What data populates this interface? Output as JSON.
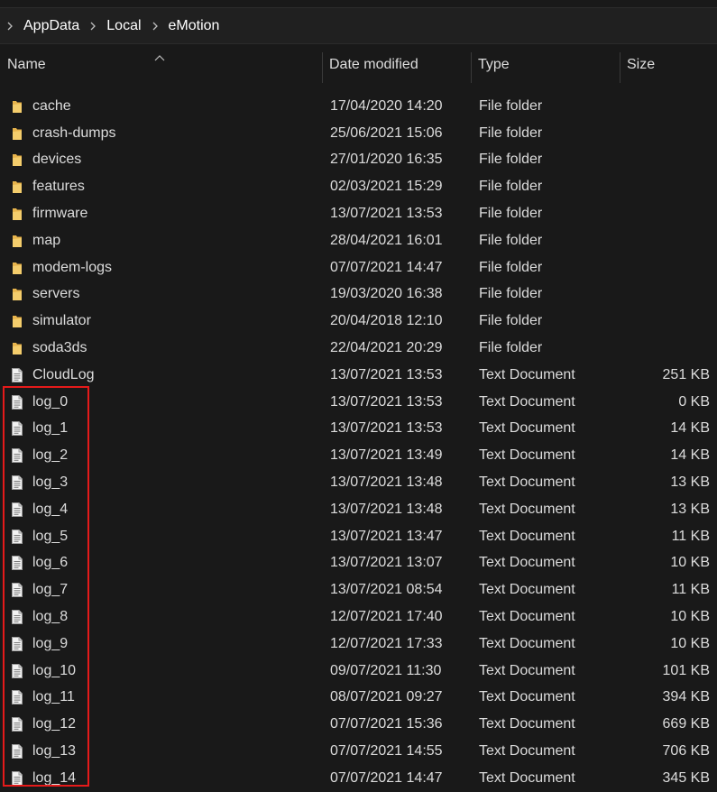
{
  "breadcrumb": {
    "items": [
      {
        "label": "AppData"
      },
      {
        "label": "Local"
      },
      {
        "label": "eMotion"
      }
    ]
  },
  "columns": {
    "name": "Name",
    "date": "Date modified",
    "type": "Type",
    "size": "Size"
  },
  "colors": {
    "background": "#191919",
    "folder": "#e8b44c",
    "text": "#dcdcdc",
    "selection_outline": "#e51a1a"
  },
  "files": [
    {
      "name": "cache",
      "date": "17/04/2020 14:20",
      "type": "File folder",
      "size": "",
      "icon": "folder-icon"
    },
    {
      "name": "crash-dumps",
      "date": "25/06/2021 15:06",
      "type": "File folder",
      "size": "",
      "icon": "folder-icon"
    },
    {
      "name": "devices",
      "date": "27/01/2020 16:35",
      "type": "File folder",
      "size": "",
      "icon": "folder-icon"
    },
    {
      "name": "features",
      "date": "02/03/2021 15:29",
      "type": "File folder",
      "size": "",
      "icon": "folder-icon"
    },
    {
      "name": "firmware",
      "date": "13/07/2021 13:53",
      "type": "File folder",
      "size": "",
      "icon": "folder-icon"
    },
    {
      "name": "map",
      "date": "28/04/2021 16:01",
      "type": "File folder",
      "size": "",
      "icon": "folder-icon"
    },
    {
      "name": "modem-logs",
      "date": "07/07/2021 14:47",
      "type": "File folder",
      "size": "",
      "icon": "folder-icon"
    },
    {
      "name": "servers",
      "date": "19/03/2020 16:38",
      "type": "File folder",
      "size": "",
      "icon": "folder-icon"
    },
    {
      "name": "simulator",
      "date": "20/04/2018 12:10",
      "type": "File folder",
      "size": "",
      "icon": "folder-icon"
    },
    {
      "name": "soda3ds",
      "date": "22/04/2021 20:29",
      "type": "File folder",
      "size": "",
      "icon": "folder-icon"
    },
    {
      "name": "CloudLog",
      "date": "13/07/2021 13:53",
      "type": "Text Document",
      "size": "251 KB",
      "icon": "text-document-icon"
    },
    {
      "name": "log_0",
      "date": "13/07/2021 13:53",
      "type": "Text Document",
      "size": "0 KB",
      "icon": "text-document-icon"
    },
    {
      "name": "log_1",
      "date": "13/07/2021 13:53",
      "type": "Text Document",
      "size": "14 KB",
      "icon": "text-document-icon"
    },
    {
      "name": "log_2",
      "date": "13/07/2021 13:49",
      "type": "Text Document",
      "size": "14 KB",
      "icon": "text-document-icon"
    },
    {
      "name": "log_3",
      "date": "13/07/2021 13:48",
      "type": "Text Document",
      "size": "13 KB",
      "icon": "text-document-icon"
    },
    {
      "name": "log_4",
      "date": "13/07/2021 13:48",
      "type": "Text Document",
      "size": "13 KB",
      "icon": "text-document-icon"
    },
    {
      "name": "log_5",
      "date": "13/07/2021 13:47",
      "type": "Text Document",
      "size": "11 KB",
      "icon": "text-document-icon"
    },
    {
      "name": "log_6",
      "date": "13/07/2021 13:07",
      "type": "Text Document",
      "size": "10 KB",
      "icon": "text-document-icon"
    },
    {
      "name": "log_7",
      "date": "13/07/2021 08:54",
      "type": "Text Document",
      "size": "11 KB",
      "icon": "text-document-icon"
    },
    {
      "name": "log_8",
      "date": "12/07/2021 17:40",
      "type": "Text Document",
      "size": "10 KB",
      "icon": "text-document-icon"
    },
    {
      "name": "log_9",
      "date": "12/07/2021 17:33",
      "type": "Text Document",
      "size": "10 KB",
      "icon": "text-document-icon"
    },
    {
      "name": "log_10",
      "date": "09/07/2021 11:30",
      "type": "Text Document",
      "size": "101 KB",
      "icon": "text-document-icon"
    },
    {
      "name": "log_11",
      "date": "08/07/2021 09:27",
      "type": "Text Document",
      "size": "394 KB",
      "icon": "text-document-icon"
    },
    {
      "name": "log_12",
      "date": "07/07/2021 15:36",
      "type": "Text Document",
      "size": "669 KB",
      "icon": "text-document-icon"
    },
    {
      "name": "log_13",
      "date": "07/07/2021 14:55",
      "type": "Text Document",
      "size": "706 KB",
      "icon": "text-document-icon"
    },
    {
      "name": "log_14",
      "date": "07/07/2021 14:47",
      "type": "Text Document",
      "size": "345 KB",
      "icon": "text-document-icon"
    }
  ]
}
